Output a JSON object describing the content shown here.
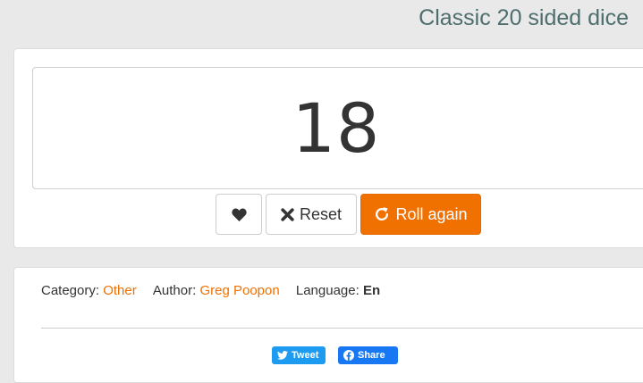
{
  "page": {
    "title": "Classic 20 sided dice"
  },
  "dice": {
    "result": "18"
  },
  "actions": {
    "favorite_icon": "heart-icon",
    "reset_label": "Reset",
    "reset_icon": "close-icon",
    "roll_label": "Roll again",
    "roll_icon": "refresh-icon"
  },
  "meta": {
    "category_label": "Category:",
    "category_value": "Other",
    "author_label": "Author:",
    "author_value": "Greg Poopon",
    "language_label": "Language:",
    "language_value": "En"
  },
  "share": {
    "tweet_label": "Tweet",
    "tweet_icon": "twitter-icon",
    "facebook_label": "Share",
    "facebook_icon": "facebook-icon"
  },
  "colors": {
    "accent": "#f07000",
    "title": "#4e6e6e",
    "twitter": "#1d9bf0",
    "facebook": "#1877f2"
  }
}
